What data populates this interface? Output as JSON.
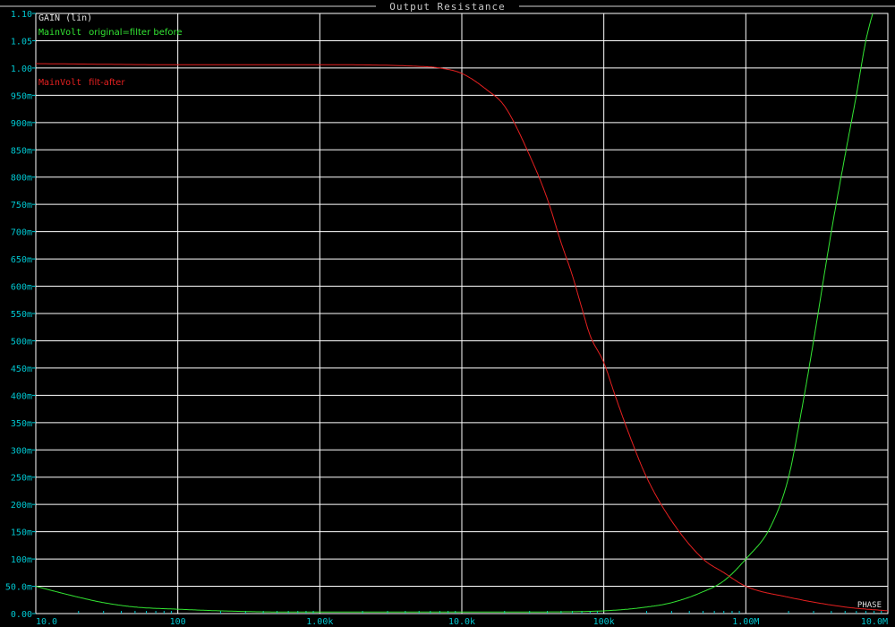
{
  "window": {
    "title": "Output Resistance"
  },
  "chart_data": {
    "type": "line",
    "title": "Output Resistance",
    "ylabel": "GAIN (lin)",
    "xlabel": "",
    "x_scale": "log",
    "xlim": [
      10,
      10000000
    ],
    "ylim": [
      0,
      1.1
    ],
    "grid": true,
    "x_ticks": [
      {
        "value": 10,
        "label": "10.0"
      },
      {
        "value": 100,
        "label": "100"
      },
      {
        "value": 1000,
        "label": "1.00k"
      },
      {
        "value": 10000,
        "label": "10.0k"
      },
      {
        "value": 100000,
        "label": "100k"
      },
      {
        "value": 1000000,
        "label": "1.00M"
      },
      {
        "value": 10000000,
        "label": "10.0M"
      }
    ],
    "y_ticks": [
      {
        "value": 0.0,
        "label": "0.00"
      },
      {
        "value": 0.05,
        "label": "50.0m"
      },
      {
        "value": 0.1,
        "label": "100m"
      },
      {
        "value": 0.15,
        "label": "150m"
      },
      {
        "value": 0.2,
        "label": "200m"
      },
      {
        "value": 0.25,
        "label": "250m"
      },
      {
        "value": 0.3,
        "label": "300m"
      },
      {
        "value": 0.35,
        "label": "350m"
      },
      {
        "value": 0.4,
        "label": "400m"
      },
      {
        "value": 0.45,
        "label": "450m"
      },
      {
        "value": 0.5,
        "label": "500m"
      },
      {
        "value": 0.55,
        "label": "550m"
      },
      {
        "value": 0.6,
        "label": "600m"
      },
      {
        "value": 0.65,
        "label": "650m"
      },
      {
        "value": 0.7,
        "label": "700m"
      },
      {
        "value": 0.75,
        "label": "750m"
      },
      {
        "value": 0.8,
        "label": "800m"
      },
      {
        "value": 0.85,
        "label": "850m"
      },
      {
        "value": 0.9,
        "label": "900m"
      },
      {
        "value": 0.95,
        "label": "950m"
      },
      {
        "value": 1.0,
        "label": "1.00"
      },
      {
        "value": 1.05,
        "label": "1.05"
      },
      {
        "value": 1.1,
        "label": "1.10"
      }
    ],
    "series": [
      {
        "name": "original=filter before",
        "prefix": "MainVolt",
        "color": "#33e633",
        "x": [
          10,
          15,
          20,
          30,
          50,
          100,
          200,
          500,
          1000,
          5000,
          10000,
          30000,
          100000,
          200000,
          300000,
          500000,
          700000,
          1000000,
          1500000,
          2000000,
          2500000,
          3000000,
          4000000,
          5000000,
          6000000,
          7000000,
          8000000
        ],
        "y": [
          0.05,
          0.038,
          0.03,
          0.02,
          0.012,
          0.008,
          0.005,
          0.003,
          0.003,
          0.003,
          0.003,
          0.003,
          0.005,
          0.012,
          0.02,
          0.04,
          0.06,
          0.1,
          0.16,
          0.25,
          0.38,
          0.5,
          0.7,
          0.84,
          0.95,
          1.05,
          1.11
        ]
      },
      {
        "name": "filt-after",
        "prefix": "MainVolt",
        "color": "#e62020",
        "x": [
          10,
          100,
          1000,
          5000,
          7000,
          10000,
          15000,
          20000,
          30000,
          40000,
          50000,
          60000,
          70000,
          80000,
          100000,
          120000,
          150000,
          200000,
          300000,
          500000,
          700000,
          1000000,
          2000000,
          5000000,
          10000000
        ],
        "y": [
          1.008,
          1.006,
          1.006,
          1.003,
          1.0,
          0.99,
          0.96,
          0.93,
          0.84,
          0.76,
          0.68,
          0.62,
          0.56,
          0.51,
          0.46,
          0.4,
          0.33,
          0.25,
          0.17,
          0.1,
          0.075,
          0.05,
          0.03,
          0.012,
          0.005
        ]
      }
    ],
    "annotation": "PHASE"
  }
}
